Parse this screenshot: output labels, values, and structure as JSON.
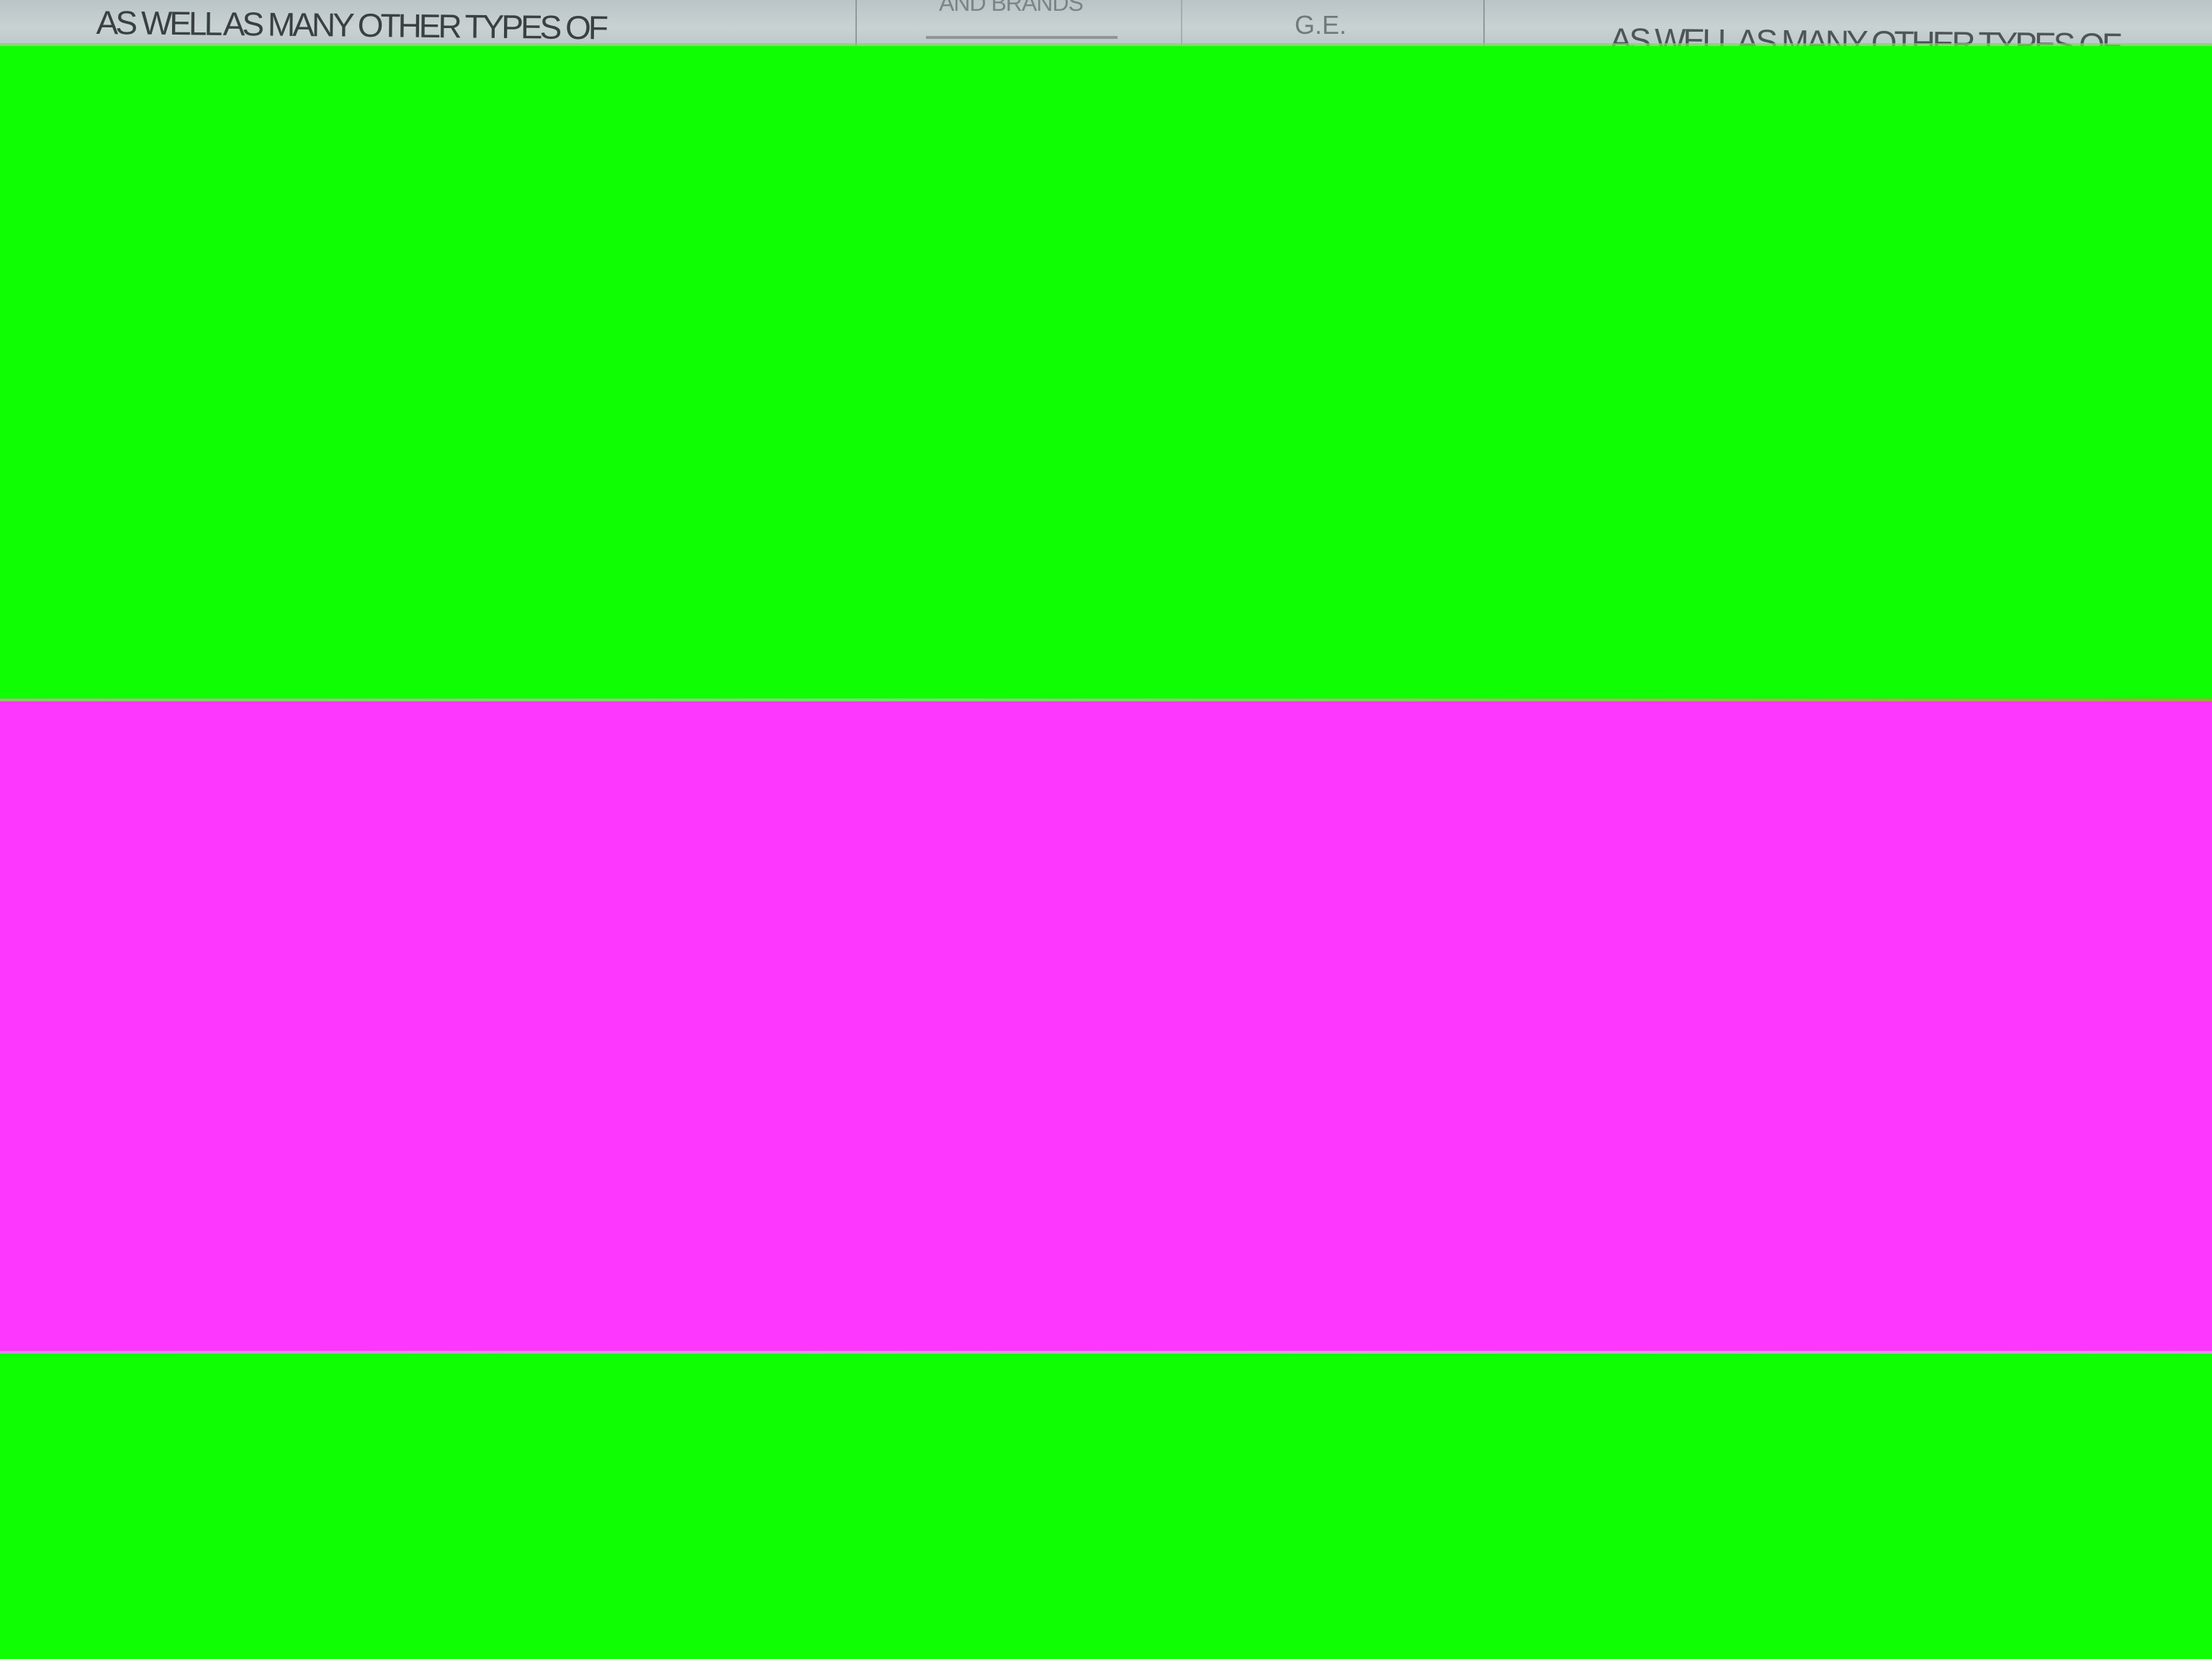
{
  "paper_strip": {
    "left_text": "AS WELL AS MANY OTHER TYPES OF",
    "brands_text": "AND BRANDS",
    "ge_text": "G.E.",
    "right_text": "AS WELL AS MANY OTHER TYPES OF"
  },
  "colors": {
    "green": "#10fe04",
    "magenta": "#fd37fd",
    "paper": "#c8d2d3"
  }
}
